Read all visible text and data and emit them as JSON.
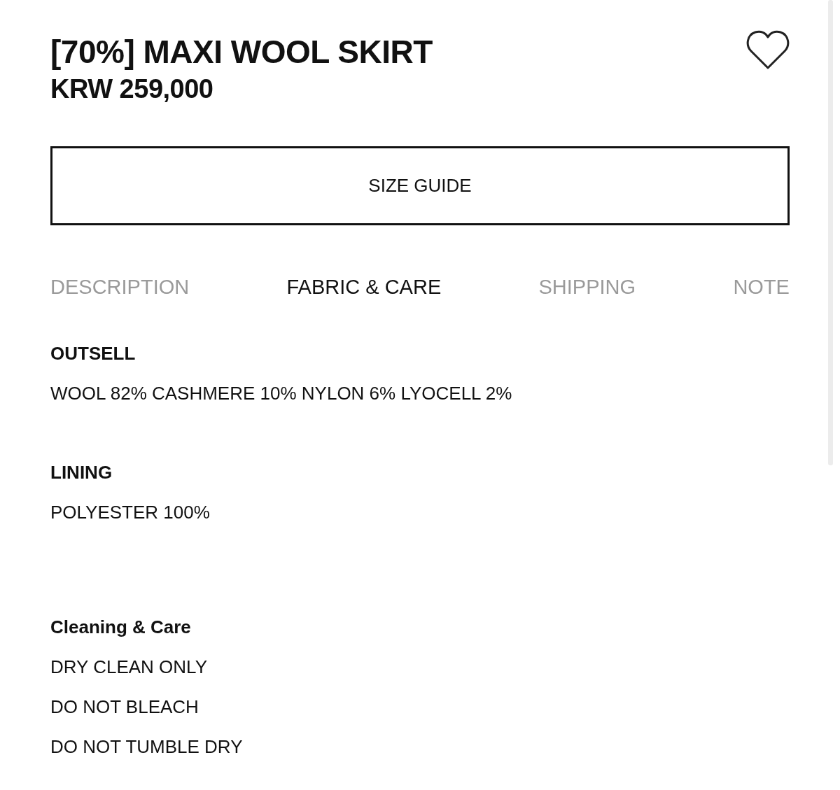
{
  "product": {
    "title": "[70%] MAXI WOOL SKIRT",
    "price": "KRW 259,000",
    "wishlisted": false
  },
  "size_guide_button": {
    "label": "SIZE GUIDE"
  },
  "tabs": [
    {
      "label": "DESCRIPTION",
      "selected": false
    },
    {
      "label": "FABRIC & CARE",
      "selected": true
    },
    {
      "label": "SHIPPING",
      "selected": false
    },
    {
      "label": "NOTE",
      "selected": false
    }
  ],
  "sections": [
    {
      "heading": "OUTSELL",
      "lines": [
        "WOOL 82% CASHMERE 10% NYLON 6% LYOCELL 2%"
      ]
    },
    {
      "heading": "LINING",
      "lines": [
        "POLYESTER 100%"
      ]
    },
    {
      "heading": "Cleaning & Care",
      "lines": [
        "DRY CLEAN ONLY",
        "DO NOT BLEACH",
        "DO NOT TUMBLE DRY"
      ]
    }
  ]
}
